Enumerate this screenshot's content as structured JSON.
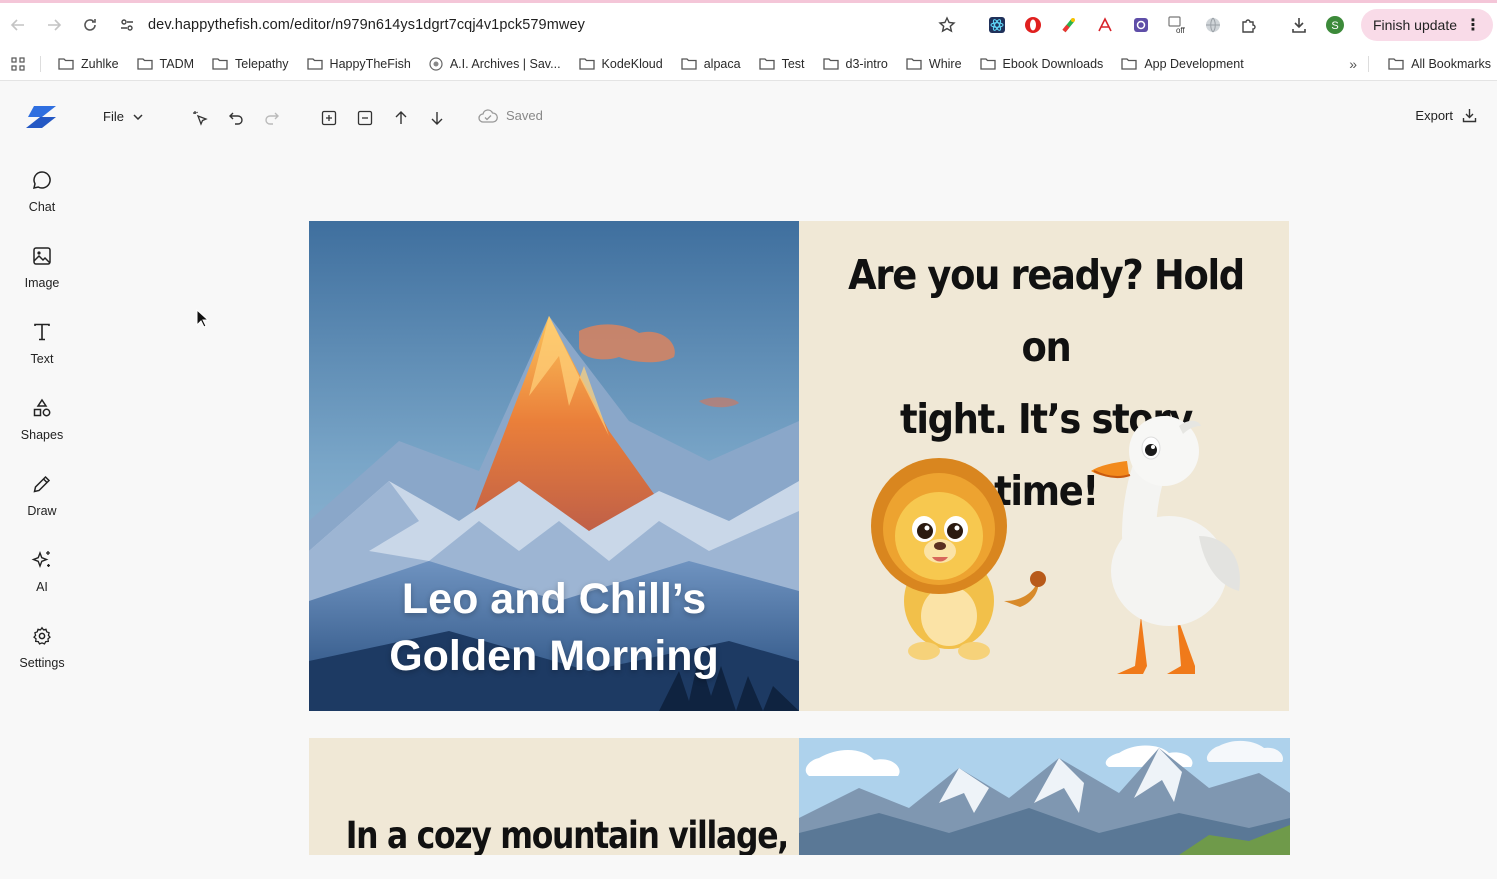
{
  "browser": {
    "url": "dev.happythefish.com/editor/n979n614ys1dgrt7cqj4v1pck579mwey",
    "finish_update_label": "Finish update",
    "profile_initial": "S",
    "bookmarks": [
      "Zuhlke",
      "TADM",
      "Telepathy",
      "HappyTheFish",
      "A.I. Archives | Sav...",
      "KodeKloud",
      "alpaca",
      "Test",
      "d3-intro",
      "Whire",
      "Ebook Downloads",
      "App Development"
    ],
    "all_bookmarks_label": "All Bookmarks"
  },
  "toolbar": {
    "file_label": "File",
    "saved_label": "Saved",
    "export_label": "Export"
  },
  "sidebar": {
    "items": [
      {
        "label": "Chat",
        "icon": "chat-icon"
      },
      {
        "label": "Image",
        "icon": "image-icon"
      },
      {
        "label": "Text",
        "icon": "text-icon"
      },
      {
        "label": "Shapes",
        "icon": "shapes-icon"
      },
      {
        "label": "Draw",
        "icon": "pencil-icon"
      },
      {
        "label": "AI",
        "icon": "sparkles-icon"
      },
      {
        "label": "Settings",
        "icon": "gear-icon"
      }
    ]
  },
  "pages": [
    {
      "title_line1": "Leo and Chill’s",
      "title_line2": "Golden Morning",
      "story_line1": "Are you ready? Hold on",
      "story_line2": "tight. It’s story time!"
    },
    {
      "story_line1": "In a cozy mountain village, lived"
    }
  ],
  "colors": {
    "accent_pink": "#f9dbe8",
    "page_cream": "#f0e8d6",
    "logo_blue": "#2f6fe0"
  }
}
